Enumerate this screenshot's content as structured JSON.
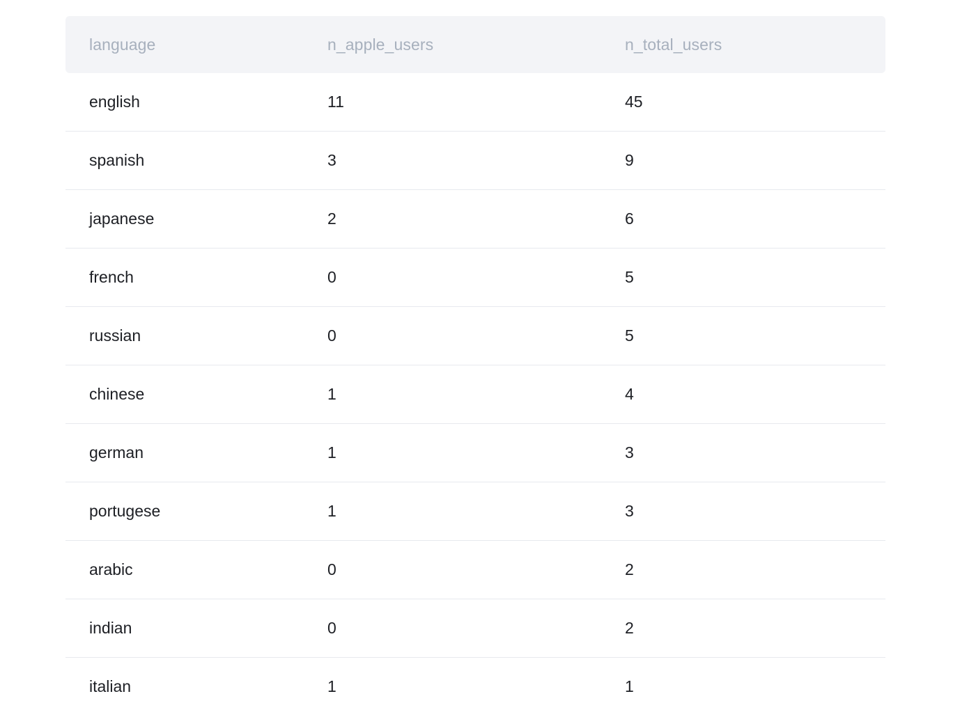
{
  "table": {
    "columns": [
      "language",
      "n_apple_users",
      "n_total_users"
    ],
    "rows": [
      [
        "english",
        "11",
        "45"
      ],
      [
        "spanish",
        "3",
        "9"
      ],
      [
        "japanese",
        "2",
        "6"
      ],
      [
        "french",
        "0",
        "5"
      ],
      [
        "russian",
        "0",
        "5"
      ],
      [
        "chinese",
        "1",
        "4"
      ],
      [
        "german",
        "1",
        "3"
      ],
      [
        "portugese",
        "1",
        "3"
      ],
      [
        "arabic",
        "0",
        "2"
      ],
      [
        "indian",
        "0",
        "2"
      ],
      [
        "italian",
        "1",
        "1"
      ]
    ]
  }
}
